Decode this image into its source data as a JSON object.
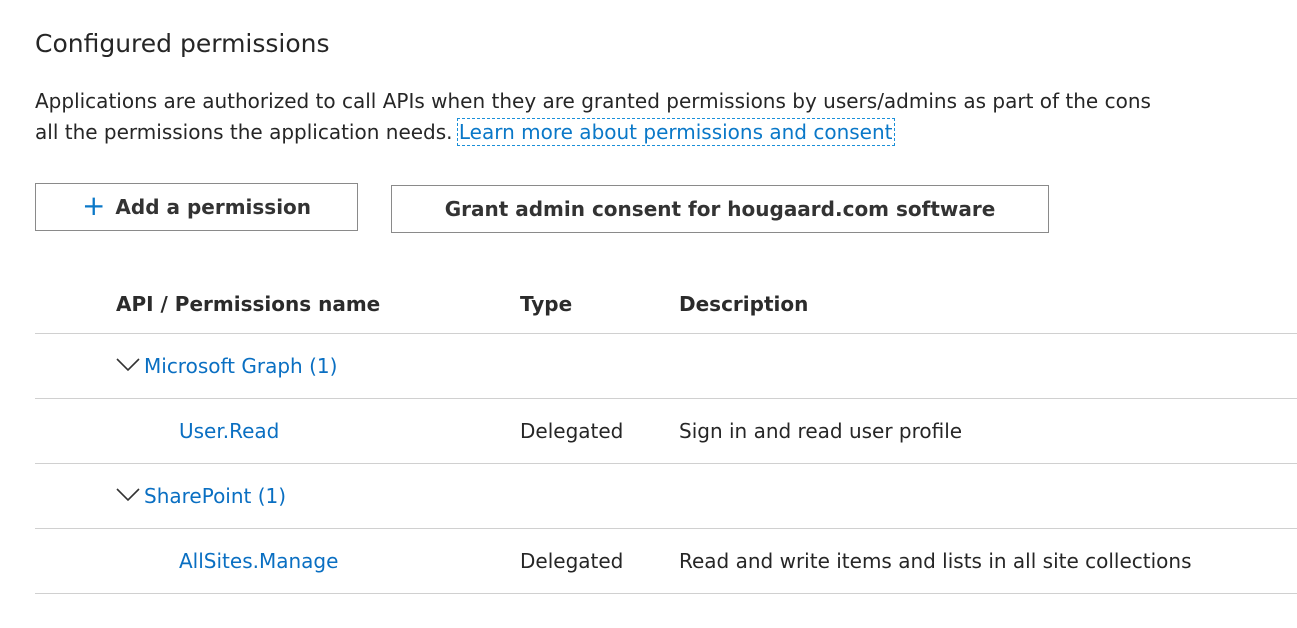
{
  "page": {
    "title": "Configured permissions",
    "intro_line1": "Applications are authorized to call APIs when they are granted permissions by users/admins as part of the cons",
    "intro_line2_prefix": "all the permissions the application needs. ",
    "learn_more_link": "Learn more about permissions and consent"
  },
  "toolbar": {
    "add_icon": "+",
    "add_label": "Add a permission",
    "grant_label": "Grant admin consent for hougaard.com software"
  },
  "table": {
    "headers": {
      "name": "API / Permissions name",
      "type": "Type",
      "description": "Description"
    },
    "groups": [
      {
        "label": "Microsoft Graph (1)",
        "permissions": [
          {
            "name": "User.Read",
            "type": "Delegated",
            "description": "Sign in and read user profile"
          }
        ]
      },
      {
        "label": "SharePoint (1)",
        "permissions": [
          {
            "name": "AllSites.Manage",
            "type": "Delegated",
            "description": "Read and write items and lists in all site collections"
          }
        ]
      }
    ]
  },
  "colors": {
    "link": "#0a6fc2",
    "accent": "#0a78c8",
    "divider": "#d0d0d0",
    "button_border": "#8a8a8a"
  },
  "icons": {
    "add": "plus-icon",
    "group_toggle": "chevron-down-icon"
  }
}
